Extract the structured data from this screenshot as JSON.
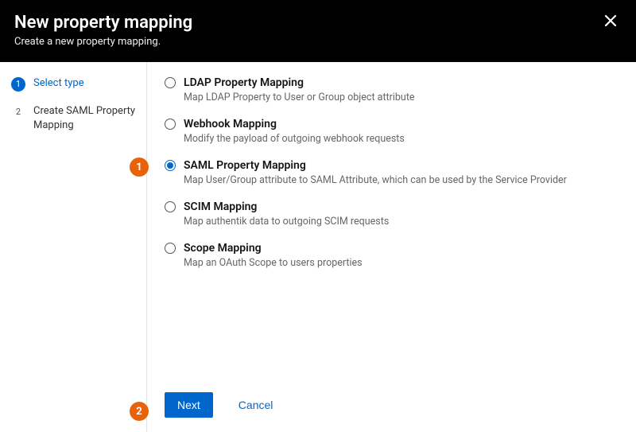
{
  "header": {
    "title": "New property mapping",
    "subtitle": "Create a new property mapping."
  },
  "sidebar": {
    "steps": [
      {
        "num": "1",
        "label": "Select type"
      },
      {
        "num": "2",
        "label": "Create SAML Property Mapping"
      }
    ]
  },
  "options": [
    {
      "title": "LDAP Property Mapping",
      "desc": "Map LDAP Property to User or Group object attribute"
    },
    {
      "title": "Webhook Mapping",
      "desc": "Modify the payload of outgoing webhook requests"
    },
    {
      "title": "SAML Property Mapping",
      "desc": "Map User/Group attribute to SAML Attribute, which can be used by the Service Provider"
    },
    {
      "title": "SCIM Mapping",
      "desc": "Map authentik data to outgoing SCIM requests"
    },
    {
      "title": "Scope Mapping",
      "desc": "Map an OAuth Scope to users properties"
    }
  ],
  "footer": {
    "next": "Next",
    "cancel": "Cancel"
  },
  "callouts": {
    "one": "1",
    "two": "2"
  }
}
